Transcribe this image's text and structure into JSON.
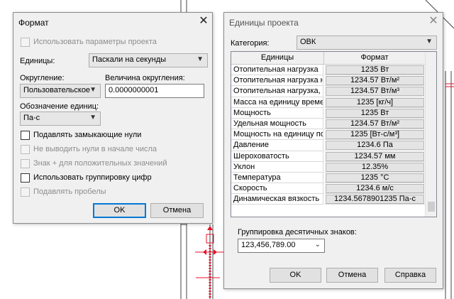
{
  "format_dialog": {
    "title": "Формат",
    "use_project_settings": "Использовать параметры проекта",
    "units_label": "Единицы:",
    "units_value": "Паскали на секунды",
    "rounding_label": "Округление:",
    "rounding_value": "Пользовательское",
    "rounding_increment_label": "Величина округления:",
    "rounding_increment_value": "0.0000000001",
    "unit_symbol_label": "Обозначение единиц:",
    "unit_symbol_value": "Па-с",
    "options": [
      {
        "label": "Подавлять замыкающие нули",
        "enabled": true,
        "checked": false
      },
      {
        "label": "Не выводить нули в начале числа",
        "enabled": false,
        "checked": false
      },
      {
        "label": "Знак + для положительных значений",
        "enabled": false,
        "checked": false
      },
      {
        "label": "Использовать группировку цифр",
        "enabled": true,
        "checked": false
      },
      {
        "label": "Подавлять пробелы",
        "enabled": false,
        "checked": false
      }
    ],
    "ok_label": "OK",
    "cancel_label": "Отмена"
  },
  "project_units_dialog": {
    "title": "Единицы проекта",
    "category_label": "Категория:",
    "category_value": "ОВК",
    "table": {
      "headers": [
        "Единицы",
        "Формат"
      ],
      "rows": [
        {
          "unit": "Отопительная нагрузка",
          "format": "1235 Вт"
        },
        {
          "unit": "Отопительная нагрузка на",
          "format": "1234.57 Вт/м²"
        },
        {
          "unit": "Отопительная нагрузка, ра",
          "format": "1234.57 Вт/м³"
        },
        {
          "unit": "Масса на единицу времен",
          "format": "1235 [кг/ч]"
        },
        {
          "unit": "Мощность",
          "format": "1235 Вт"
        },
        {
          "unit": "Удельная мощность",
          "format": "1234.57 Вт/м²"
        },
        {
          "unit": "Мощность на единицу пот",
          "format": "1235 [Вт-с/м³]"
        },
        {
          "unit": "Давление",
          "format": "1234.6 Па"
        },
        {
          "unit": "Шероховатость",
          "format": "1234.57 мм"
        },
        {
          "unit": "Уклон",
          "format": "12.35%"
        },
        {
          "unit": "Температура",
          "format": "1235 °C"
        },
        {
          "unit": "Скорость",
          "format": "1234.6 м/с"
        },
        {
          "unit": "Динамическая вязкость",
          "format": "1234.5678901235 Па-с"
        }
      ]
    },
    "decimal_grouping_label": "Группировка десятичных знаков:",
    "decimal_grouping_value": "123,456,789.00",
    "ok_label": "OK",
    "cancel_label": "Отмена",
    "help_label": "Справка"
  },
  "colors": {
    "dialog_bg": "#f0f0f0",
    "accent": "#0078d7",
    "cad_red": "#e8102a"
  }
}
